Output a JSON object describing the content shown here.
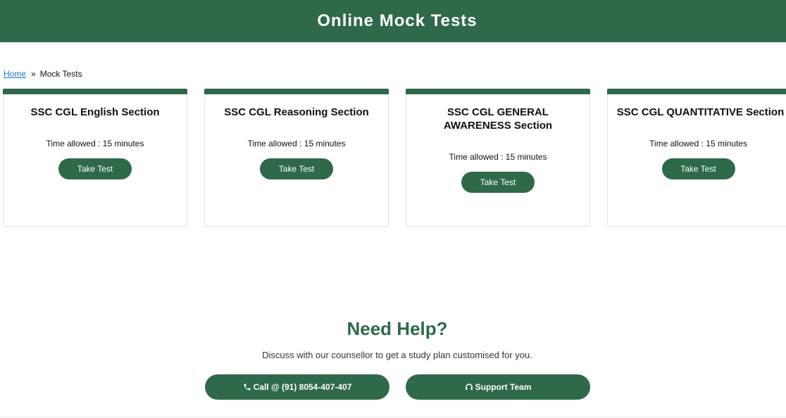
{
  "header": {
    "title": "Online Mock Tests"
  },
  "breadcrumb": {
    "home": "Home",
    "separator": "»",
    "current": "Mock Tests"
  },
  "cards": [
    {
      "title": "SSC CGL English Section",
      "time": "Time allowed : 15 minutes",
      "button": "Take Test"
    },
    {
      "title": "SSC CGL Reasoning Section",
      "time": "Time allowed : 15 minutes",
      "button": "Take Test"
    },
    {
      "title": "SSC CGL GENERAL AWARENESS Section",
      "time": "Time allowed : 15 minutes",
      "button": "Take Test"
    },
    {
      "title": "SSC CGL QUANTITATIVE Section",
      "time": "Time allowed : 15 minutes",
      "button": "Take Test"
    }
  ],
  "help": {
    "title": "Need Help?",
    "subtitle": "Discuss with our counsellor to get a study plan customised for you.",
    "call_button": "Call @ (91) 8054-407-407",
    "support_button": "Support Team",
    "call_icon": "phone-icon",
    "support_icon": "headset-icon"
  },
  "colors": {
    "brand": "#2e6a4a",
    "link": "#1a73c9"
  }
}
